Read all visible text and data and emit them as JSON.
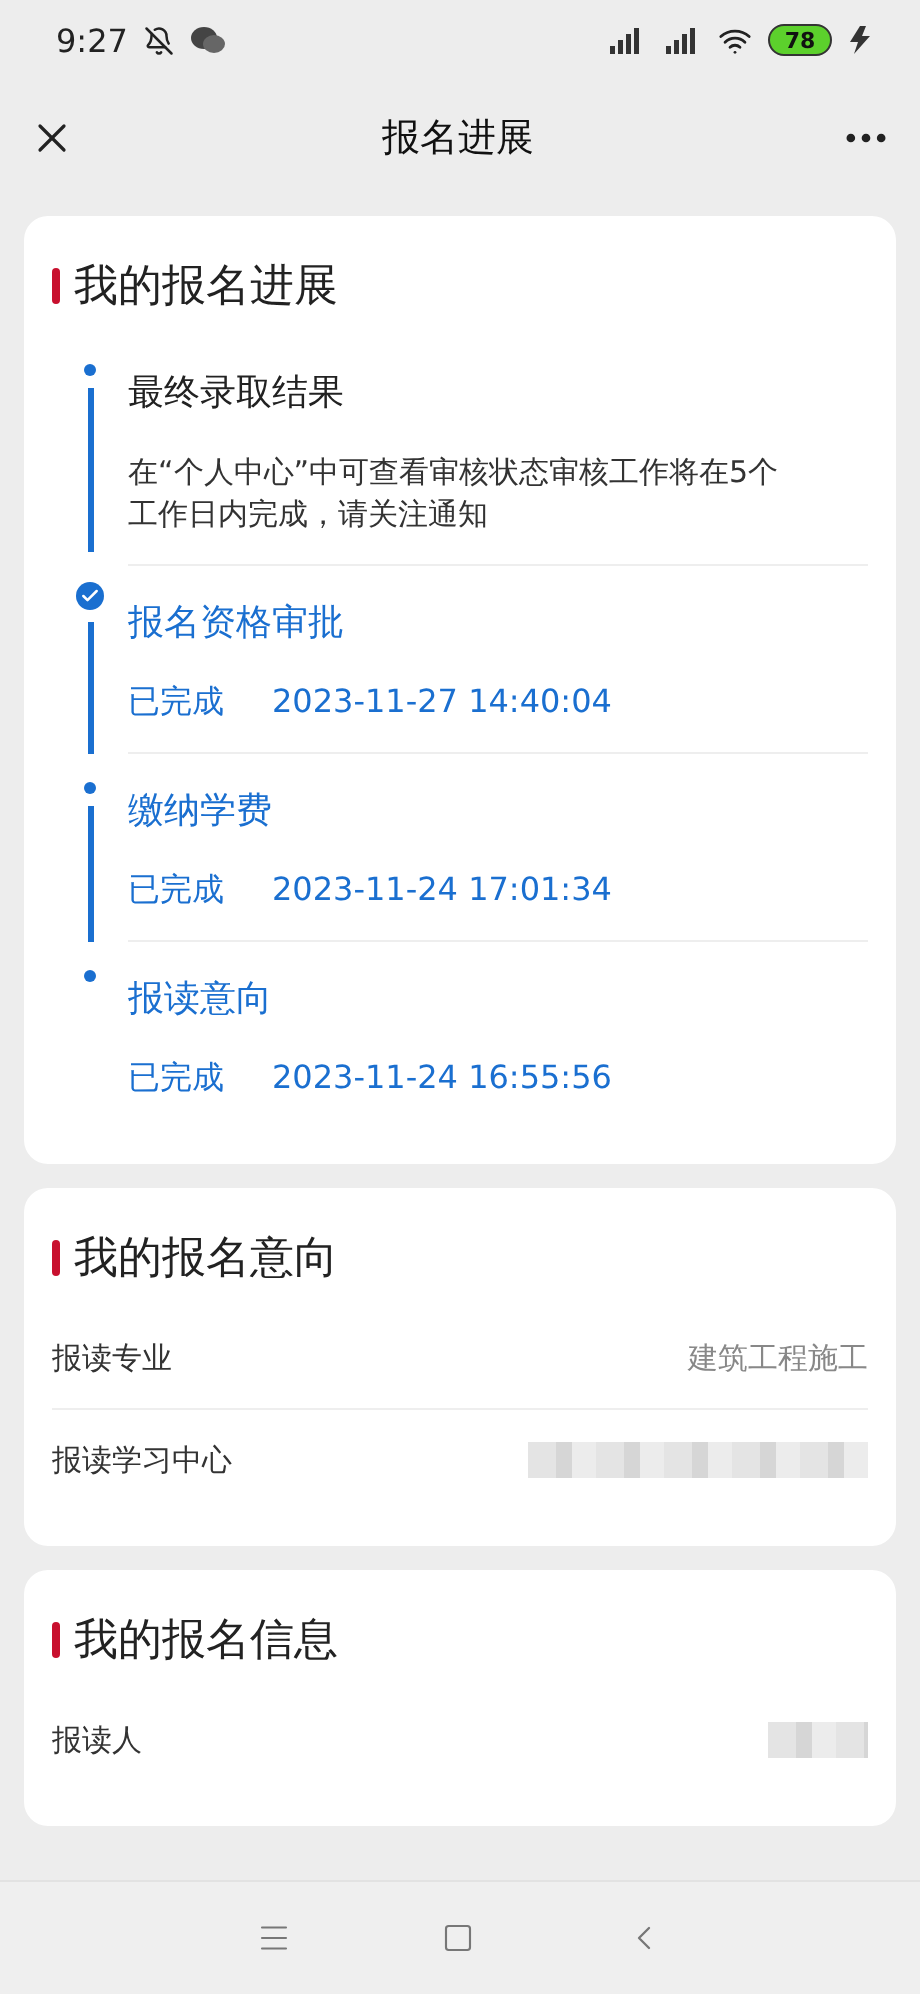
{
  "status_bar": {
    "time": "9:27",
    "battery": "78"
  },
  "nav": {
    "title": "报名进展"
  },
  "progress": {
    "title": "我的报名进展",
    "steps": [
      {
        "title": "最终录取结果",
        "done": false,
        "kind": "dot",
        "description": "在“个人中心”中可查看审核状态审核工作将在5个工作日内完成，请关注通知"
      },
      {
        "title": "报名资格审批",
        "done": true,
        "kind": "check",
        "status": "已完成",
        "time": "2023-11-27 14:40:04"
      },
      {
        "title": "缴纳学费",
        "done": true,
        "kind": "dot",
        "status": "已完成",
        "time": "2023-11-24 17:01:34"
      },
      {
        "title": "报读意向",
        "done": true,
        "kind": "dot",
        "status": "已完成",
        "time": "2023-11-24 16:55:56"
      }
    ]
  },
  "intention": {
    "title": "我的报名意向",
    "rows": [
      {
        "label": "报读专业",
        "value": "建筑工程施工",
        "kind": "text"
      },
      {
        "label": "报读学习中心",
        "kind": "redacted"
      }
    ]
  },
  "info": {
    "title": "我的报名信息",
    "rows": [
      {
        "label": "报读人",
        "kind": "redacted"
      }
    ]
  }
}
